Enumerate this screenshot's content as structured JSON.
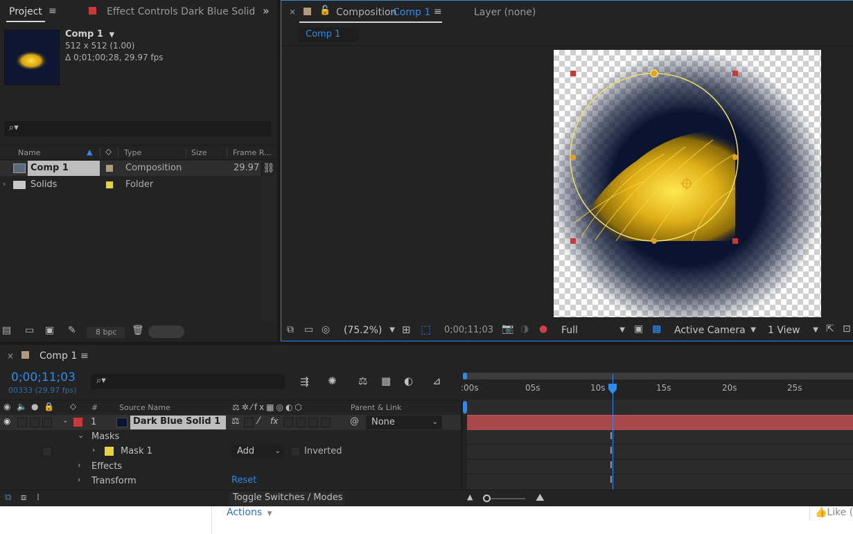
{
  "project_panel": {
    "tab_label": "Project",
    "effect_controls_label": "Effect Controls Dark Blue Solid",
    "comp_name": "Comp 1",
    "comp_size": "512 x 512 (1.00)",
    "comp_duration": "Δ 0;01;00;28, 29.97 fps",
    "columns": {
      "name": "Name",
      "type": "Type",
      "size": "Size",
      "frame_rate": "Frame R..."
    },
    "items": [
      {
        "name": "Comp 1",
        "type": "Composition",
        "frame_rate": "29.97",
        "label_color": "#b09a80"
      },
      {
        "name": "Solids",
        "type": "Folder",
        "frame_rate": "",
        "label_color": "#e6d23a"
      }
    ],
    "bpc_label": "8 bpc"
  },
  "composition_panel": {
    "tab_prefix": "Composition",
    "tab_comp": "Comp 1",
    "layer_tab": "Layer  (none)",
    "subtab": "Comp 1",
    "zoom": "(75.2%)",
    "timecode": "0;00;11;03",
    "resolution": "Full",
    "camera": "Active Camera",
    "views": "1 View"
  },
  "timeline": {
    "tab_label": "Comp 1",
    "current_time": "0;00;11;03",
    "frame_info": "00333 (29.97 fps)",
    "columns": {
      "number": "#",
      "source_name": "Source Name",
      "parent": "Parent & Link"
    },
    "layer": {
      "number": "1",
      "name": "Dark Blue Solid 1",
      "parent": "None"
    },
    "props": {
      "masks": "Masks",
      "mask1": "Mask 1",
      "mask_mode": "Add",
      "inverted": "Inverted",
      "effects": "Effects",
      "transform": "Transform",
      "reset": "Reset"
    },
    "ruler_labels": [
      ":00s",
      "05s",
      "10s",
      "15s",
      "20s",
      "25s"
    ],
    "toggle_label": "Toggle Switches / Modes"
  },
  "footer": {
    "actions": "Actions",
    "like": "Like ("
  },
  "colors": {
    "accent": "#2d8ceb",
    "layer_bar": "#a8474c",
    "label_red": "#c83a3a",
    "mask_yellow": "#e6d23a",
    "dark_blue": "#0a1430"
  }
}
